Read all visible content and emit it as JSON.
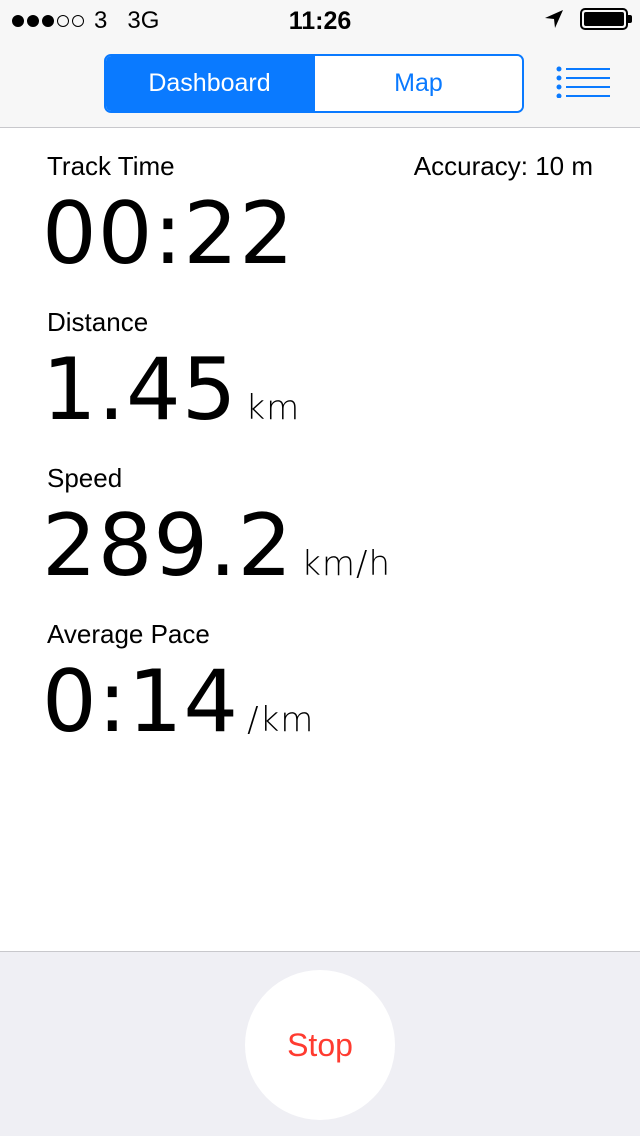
{
  "status_bar": {
    "signal_full": 3,
    "signal_total": 5,
    "carrier": "3",
    "network": "3G",
    "time": "11:26",
    "location_icon": "location-arrow-icon",
    "battery_icon": "battery-icon"
  },
  "nav": {
    "tabs": [
      {
        "label": "Dashboard",
        "active": true
      },
      {
        "label": "Map",
        "active": false
      }
    ],
    "menu_icon": "list-menu-icon"
  },
  "stats": {
    "track_time": {
      "label": "Track Time",
      "value": "00:22"
    },
    "accuracy": {
      "label": "Accuracy:",
      "value": "10 m"
    },
    "distance": {
      "label": "Distance",
      "value": "1.45",
      "unit": "km"
    },
    "speed": {
      "label": "Speed",
      "value": "289.2",
      "unit": "km/h"
    },
    "average_pace": {
      "label": "Average Pace",
      "value": "0:14",
      "unit": "/km"
    }
  },
  "actions": {
    "stop_label": "Stop"
  },
  "colors": {
    "accent": "#0a7aff",
    "stop": "#ff3b30",
    "bar_bg": "#f7f7f7",
    "bottom_bg": "#efeff4"
  }
}
